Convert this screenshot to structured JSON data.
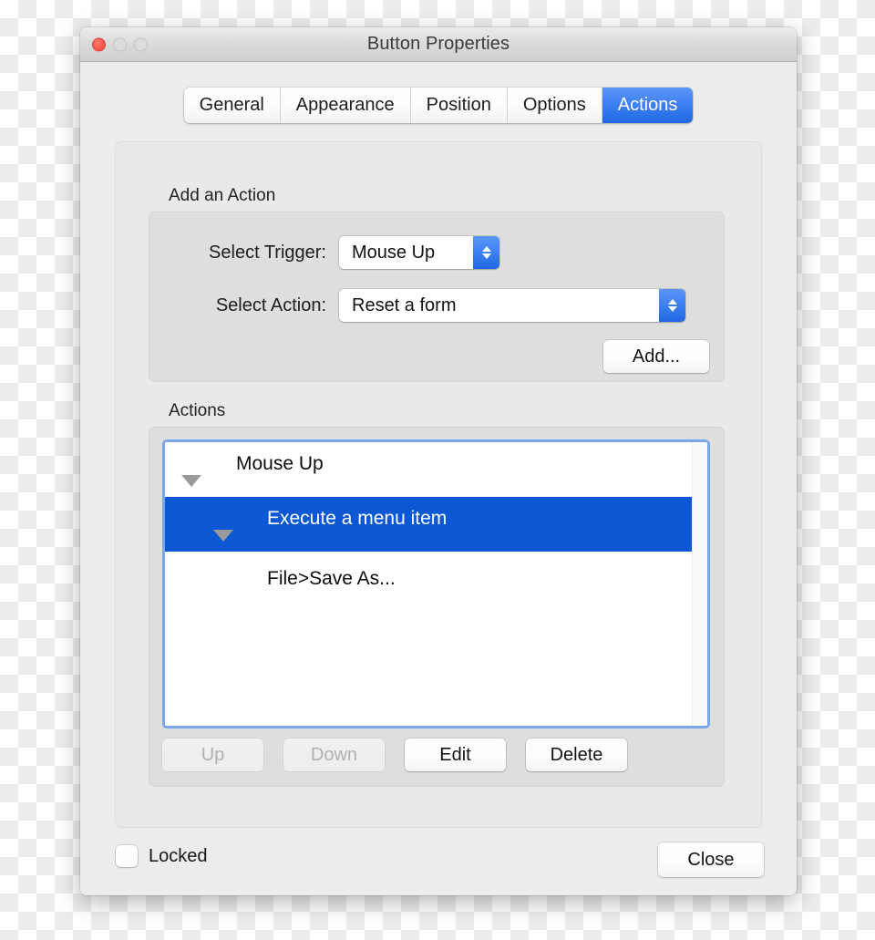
{
  "window": {
    "title": "Button Properties",
    "traffic_lights": {
      "close": "close-button-red",
      "minimize": "minimize-button-disabled",
      "zoom": "zoom-button-disabled"
    }
  },
  "tabs": [
    {
      "label": "General",
      "selected": false
    },
    {
      "label": "Appearance",
      "selected": false
    },
    {
      "label": "Position",
      "selected": false
    },
    {
      "label": "Options",
      "selected": false
    },
    {
      "label": "Actions",
      "selected": true
    }
  ],
  "add_action": {
    "group_label": "Add an Action",
    "trigger": {
      "label": "Select Trigger:",
      "value": "Mouse Up"
    },
    "action": {
      "label": "Select Action:",
      "value": "Reset a form"
    },
    "add_button": "Add..."
  },
  "actions": {
    "group_label": "Actions",
    "tree": [
      {
        "depth": 0,
        "label": "Mouse Up",
        "expanded": true,
        "selected": false,
        "has_twisty": true
      },
      {
        "depth": 1,
        "label": "Execute a menu item",
        "expanded": true,
        "selected": true,
        "has_twisty": true
      },
      {
        "depth": 2,
        "label": "File>Save As...",
        "expanded": false,
        "selected": false,
        "has_twisty": false
      }
    ],
    "buttons": [
      {
        "label": "Up",
        "enabled": false
      },
      {
        "label": "Down",
        "enabled": false
      },
      {
        "label": "Edit",
        "enabled": true
      },
      {
        "label": "Delete",
        "enabled": true
      }
    ]
  },
  "footer": {
    "locked_label": "Locked",
    "locked_checked": false,
    "close_label": "Close"
  },
  "colors": {
    "accent_blue": "#1f67e3",
    "selection_blue": "#0b57d4",
    "focus_ring": "#7ba7e8",
    "window_bg": "#ececec",
    "groupbox_bg": "#dededd",
    "close_red": "#f9564a"
  }
}
